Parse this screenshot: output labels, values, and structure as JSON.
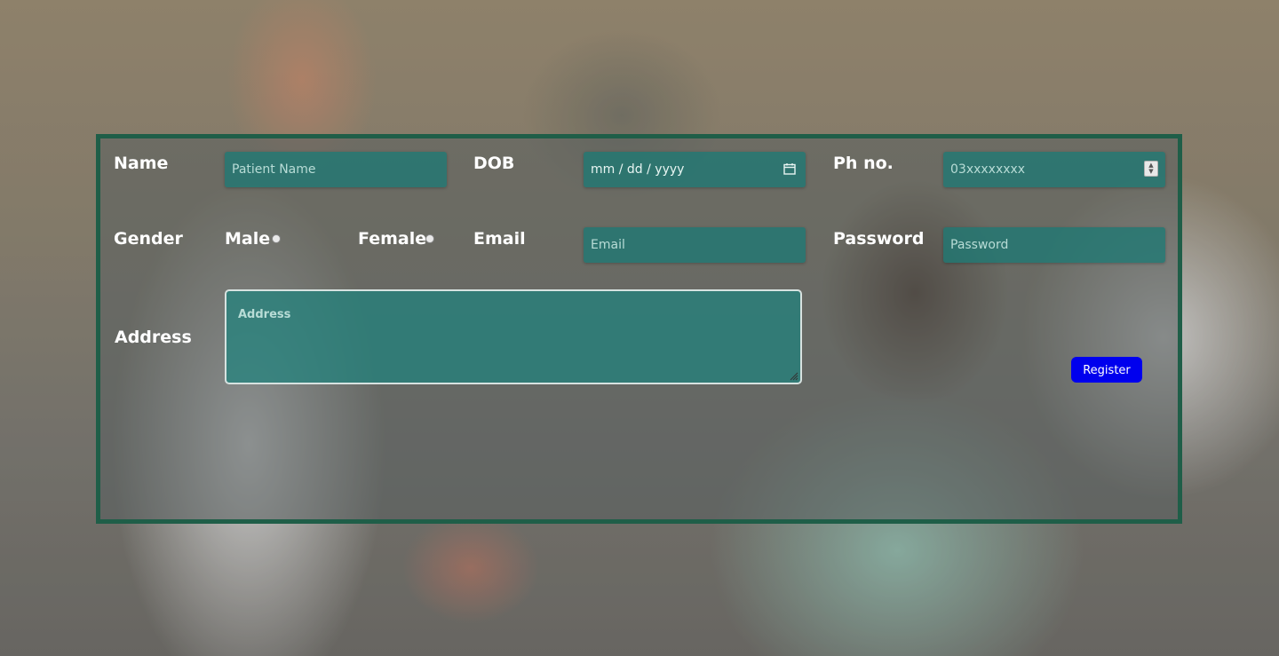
{
  "form": {
    "name": {
      "label": "Name",
      "placeholder": "Patient Name"
    },
    "dob": {
      "label": "DOB",
      "value": "mm / dd / yyyy",
      "icon": "calendar-icon"
    },
    "phone": {
      "label": "Ph no.",
      "placeholder": "03xxxxxxxx",
      "icon": "spinner-icon"
    },
    "gender": {
      "label": "Gender",
      "options": [
        {
          "label": "Male"
        },
        {
          "label": "Female"
        }
      ]
    },
    "email": {
      "label": "Email",
      "placeholder": "Email"
    },
    "password": {
      "label": "Password",
      "placeholder": "Password"
    },
    "address": {
      "label": "Address",
      "placeholder": "Address"
    },
    "register_button": {
      "label": "Register"
    }
  },
  "colors": {
    "panel_border": "#1f5e48",
    "field_bg": "#1e7873",
    "button_bg": "#0000ee"
  }
}
